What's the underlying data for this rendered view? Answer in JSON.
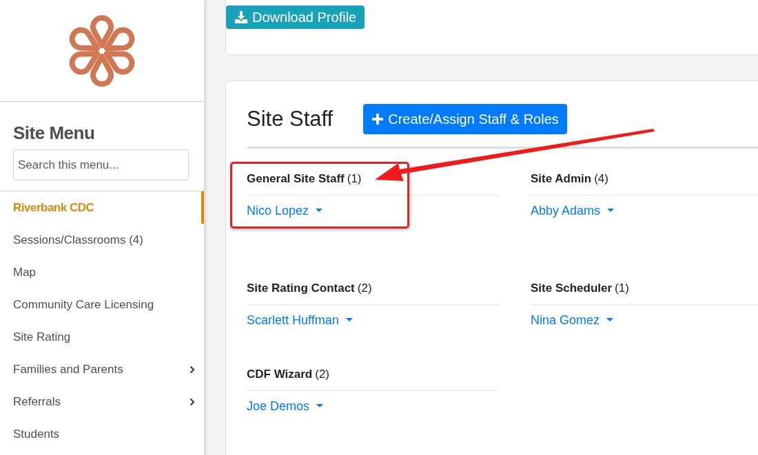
{
  "sidebar": {
    "title": "Site Menu",
    "search": {
      "placeholder": "Search this menu..."
    },
    "items": [
      {
        "label": "Riverbank CDC",
        "selected": true,
        "expandable": false
      },
      {
        "label": "Sessions/Classrooms (4)",
        "selected": false,
        "expandable": false
      },
      {
        "label": "Map",
        "selected": false,
        "expandable": false
      },
      {
        "label": "Community Care Licensing",
        "selected": false,
        "expandable": false
      },
      {
        "label": "Site Rating",
        "selected": false,
        "expandable": false
      },
      {
        "label": "Families and Parents",
        "selected": false,
        "expandable": true
      },
      {
        "label": "Referrals",
        "selected": false,
        "expandable": true
      },
      {
        "label": "Students",
        "selected": false,
        "expandable": false
      }
    ]
  },
  "download_button": "Download Profile",
  "site_staff": {
    "title": "Site Staff",
    "create_button": "Create/Assign Staff & Roles",
    "roles": [
      {
        "title": "General Site Staff",
        "count": "(1)",
        "highlighted": true,
        "members": [
          "Nico Lopez"
        ]
      },
      {
        "title": "Site Admin",
        "count": "(4)",
        "highlighted": false,
        "members": [
          "Abby Adams"
        ]
      },
      {
        "title": "Site Rating Contact",
        "count": "(2)",
        "highlighted": false,
        "members": [
          "Scarlett Huffman"
        ]
      },
      {
        "title": "Site Scheduler",
        "count": "(1)",
        "highlighted": false,
        "members": [
          "Nina Gomez"
        ]
      },
      {
        "title": "CDF Wizard",
        "count": "(2)",
        "highlighted": false,
        "members": [
          "Joe Demos"
        ]
      }
    ]
  }
}
